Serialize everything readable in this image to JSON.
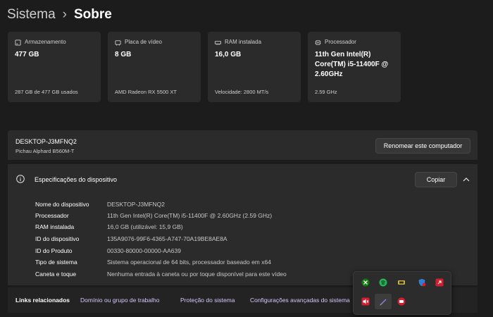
{
  "breadcrumb": {
    "parent": "Sistema",
    "separator": "›",
    "current": "Sobre"
  },
  "cards": [
    {
      "icon": "storage-icon",
      "label": "Armazenamento",
      "value": "477 GB",
      "sub": "287 GB de 477 GB usados"
    },
    {
      "icon": "gpu-icon",
      "label": "Placa de vídeo",
      "value": "8 GB",
      "sub": "AMD Radeon RX 5500 XT"
    },
    {
      "icon": "ram-icon",
      "label": "RAM instalada",
      "value": "16,0 GB",
      "sub": "Velocidade: 2800 MT/s"
    },
    {
      "icon": "cpu-icon",
      "label": "Processador",
      "value": "11th Gen Intel(R) Core(TM) i5-11400F @ 2.60GHz",
      "sub": "2.59 GHz"
    }
  ],
  "pc": {
    "name": "DESKTOP-J3MFNQ2",
    "model": "Pichau Alphard B560M-T",
    "rename_label": "Renomear este computador"
  },
  "specs": {
    "title": "Especificações do dispositivo",
    "copy_label": "Copiar",
    "rows": [
      {
        "key": "Nome do dispositivo",
        "value": "DESKTOP-J3MFNQ2"
      },
      {
        "key": "Processador",
        "value": "11th Gen Intel(R) Core(TM) i5-11400F @ 2.60GHz (2.59 GHz)"
      },
      {
        "key": "RAM instalada",
        "value": "16,0 GB (utilizável: 15,9 GB)"
      },
      {
        "key": "ID do dispositivo",
        "value": "135A9076-99F6-4365-A747-70A19BE8AE8A"
      },
      {
        "key": "ID do Produto",
        "value": "00330-80000-00000-AA639"
      },
      {
        "key": "Tipo de sistema",
        "value": "Sistema operacional de 64 bits, processador baseado em x64"
      },
      {
        "key": "Caneta e toque",
        "value": "Nenhuma entrada à caneta ou por toque disponível para este vídeo"
      }
    ]
  },
  "links": {
    "title": "Links relacionados",
    "items": [
      "Domínio ou grupo de trabalho",
      "Proteção do sistema",
      "Configurações avançadas do sistema"
    ]
  },
  "tray": {
    "icons": [
      "xbox-icon",
      "spotify-icon",
      "nvidia-icon",
      "defender-icon",
      "amd-icon",
      "speaker-muted-icon",
      "pen-icon",
      "amd-software-icon"
    ],
    "colors": {
      "xbox": "#107c10",
      "spotify": "#1db954",
      "amd": "#d11f2f",
      "defender": "#2f7fd6",
      "gpu_tool": "#c7b13a",
      "pen": "#9b7be0"
    }
  },
  "theme": {
    "background": "#1c1c1c",
    "card": "#2b2b2b",
    "link": "#d8c8ff"
  }
}
